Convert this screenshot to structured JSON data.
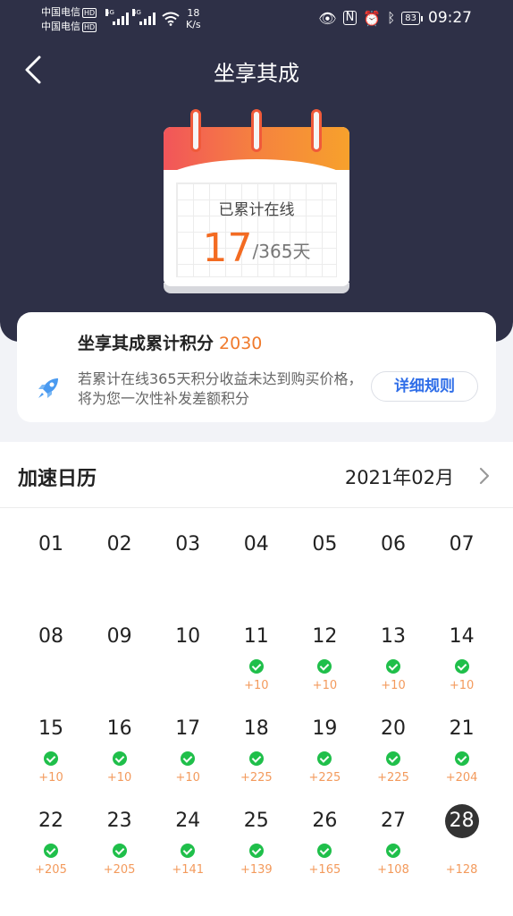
{
  "status_bar": {
    "carrier_1": "中国电信",
    "carrier_2": "中国电信",
    "hd": "HD",
    "net_1": "4G",
    "net_2": "4G",
    "speed_value": "18",
    "speed_unit": "K/s",
    "battery": "83",
    "time": "09:27",
    "icons": [
      "eye-icon",
      "nfc-icon",
      "alarm-icon",
      "bluetooth-icon"
    ]
  },
  "header": {
    "title": "坐享其成"
  },
  "calendar_card": {
    "label": "已累计在线",
    "days_count": "17",
    "days_total": "/365天"
  },
  "points_card": {
    "title": "坐享其成累计积分",
    "points": "2030",
    "description": "若累计在线365天积分收益未达到购买价格，将为您一次性补发差额积分",
    "rules_button": "详细规则"
  },
  "accel_calendar": {
    "title": "加速日历",
    "month": "2021年02月",
    "days": [
      {
        "d": "01",
        "checked": false,
        "pts": ""
      },
      {
        "d": "02",
        "checked": false,
        "pts": ""
      },
      {
        "d": "03",
        "checked": false,
        "pts": ""
      },
      {
        "d": "04",
        "checked": false,
        "pts": ""
      },
      {
        "d": "05",
        "checked": false,
        "pts": ""
      },
      {
        "d": "06",
        "checked": false,
        "pts": ""
      },
      {
        "d": "07",
        "checked": false,
        "pts": ""
      },
      {
        "d": "08",
        "checked": false,
        "pts": ""
      },
      {
        "d": "09",
        "checked": false,
        "pts": ""
      },
      {
        "d": "10",
        "checked": false,
        "pts": ""
      },
      {
        "d": "11",
        "checked": true,
        "pts": "+10"
      },
      {
        "d": "12",
        "checked": true,
        "pts": "+10"
      },
      {
        "d": "13",
        "checked": true,
        "pts": "+10"
      },
      {
        "d": "14",
        "checked": true,
        "pts": "+10"
      },
      {
        "d": "15",
        "checked": true,
        "pts": "+10"
      },
      {
        "d": "16",
        "checked": true,
        "pts": "+10"
      },
      {
        "d": "17",
        "checked": true,
        "pts": "+10"
      },
      {
        "d": "18",
        "checked": true,
        "pts": "+225"
      },
      {
        "d": "19",
        "checked": true,
        "pts": "+225"
      },
      {
        "d": "20",
        "checked": true,
        "pts": "+225"
      },
      {
        "d": "21",
        "checked": true,
        "pts": "+204"
      },
      {
        "d": "22",
        "checked": true,
        "pts": "+205"
      },
      {
        "d": "23",
        "checked": true,
        "pts": "+205"
      },
      {
        "d": "24",
        "checked": true,
        "pts": "+141"
      },
      {
        "d": "25",
        "checked": true,
        "pts": "+139"
      },
      {
        "d": "26",
        "checked": true,
        "pts": "+165"
      },
      {
        "d": "27",
        "checked": true,
        "pts": "+108"
      },
      {
        "d": "28",
        "checked": false,
        "today": true,
        "pts": "+128"
      }
    ]
  }
}
